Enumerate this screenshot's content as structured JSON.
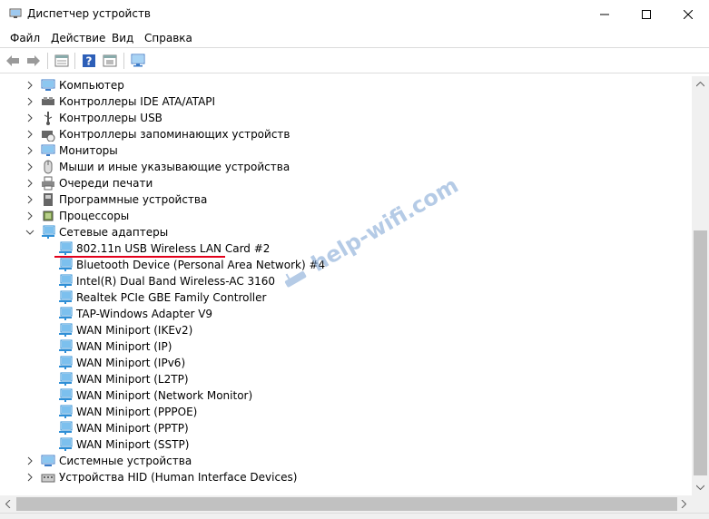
{
  "window": {
    "title": "Диспетчер устройств"
  },
  "menu": [
    "Файл",
    "Действие",
    "Вид",
    "Справка"
  ],
  "tree": {
    "categories_top": [
      {
        "label": "Компьютер",
        "icon": "computer-icon"
      },
      {
        "label": "Контроллеры IDE ATA/ATAPI",
        "icon": "ide-controller-icon"
      },
      {
        "label": "Контроллеры USB",
        "icon": "usb-icon"
      },
      {
        "label": "Контроллеры запоминающих устройств",
        "icon": "storage-controller-icon"
      },
      {
        "label": "Мониторы",
        "icon": "monitor-icon"
      },
      {
        "label": "Мыши и иные указывающие устройства",
        "icon": "mouse-icon"
      },
      {
        "label": "Очереди печати",
        "icon": "printer-icon"
      },
      {
        "label": "Программные устройства",
        "icon": "software-device-icon"
      },
      {
        "label": "Процессоры",
        "icon": "processor-icon"
      }
    ],
    "network": {
      "label": "Сетевые адаптеры",
      "expanded": true,
      "children": [
        "802.11n USB Wireless LAN Card #2",
        "Bluetooth Device (Personal Area Network) #4",
        "Intel(R) Dual Band Wireless-AC 3160",
        "Realtek PCIe GBE Family Controller",
        "TAP-Windows Adapter V9",
        "WAN Miniport (IKEv2)",
        "WAN Miniport (IP)",
        "WAN Miniport (IPv6)",
        "WAN Miniport (L2TP)",
        "WAN Miniport (Network Monitor)",
        "WAN Miniport (PPPOE)",
        "WAN Miniport (PPTP)",
        "WAN Miniport (SSTP)"
      ]
    },
    "categories_bottom": [
      {
        "label": "Системные устройства",
        "icon": "system-device-icon"
      },
      {
        "label": "Устройства HID (Human Interface Devices)",
        "icon": "hid-icon"
      }
    ]
  },
  "watermark": "help-wifi.com",
  "colors": {
    "highlight": "#e3001b",
    "network_icon": "#2f8fd6"
  }
}
